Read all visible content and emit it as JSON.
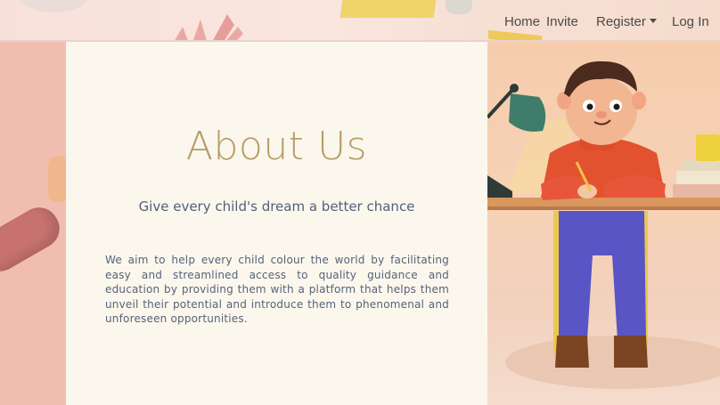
{
  "nav": {
    "home_label": "Home",
    "invite_label": "Invite",
    "register_label": "Register",
    "login_label": "Log In"
  },
  "about": {
    "title": "About Us",
    "tagline": "Give every child's dream a better chance",
    "mission": "We aim to help every child colour the world by facilitating easy and streamlined access to quality guidance and education by providing them with a platform that helps them unveil their potential and introduce them to phenomenal and unforeseen opportunities."
  },
  "colors": {
    "title": "#b79c6a",
    "body_text": "#56627a",
    "content_background": "#fbf7ec",
    "side_pink": "#f2bdb1"
  }
}
